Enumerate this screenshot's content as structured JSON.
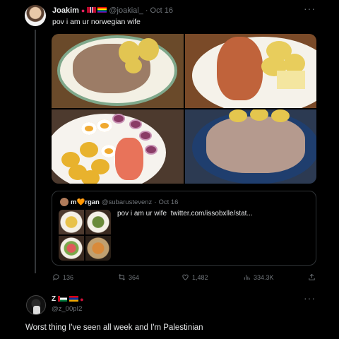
{
  "tweet": {
    "author_name": "Joakim",
    "author_emojis": "📍🇳🇴🏳️‍🌈",
    "handle": "@joakial_",
    "separator": "·",
    "date": "Oct 16",
    "text": "pov i am ur norwegian wife",
    "more": "···",
    "images": [
      "food-photo-1",
      "food-photo-2",
      "food-photo-3",
      "food-photo-4"
    ]
  },
  "quote": {
    "author_name": "m🧡rgan",
    "handle": "@subarustevenz",
    "separator": "·",
    "date": "Oct 16",
    "text": "pov i am ur wife",
    "link": "twitter.com/issobxlle/stat..."
  },
  "actions": {
    "replies": "136",
    "retweets": "364",
    "likes": "1,482",
    "views": "334.3K"
  },
  "reply": {
    "author_name": "Z",
    "handle": "@z_00pI2",
    "more": "···",
    "text": "Worst thing I've seen all week and I'm Palestinian"
  },
  "colors": {
    "background": "#000000",
    "text": "#e7e9ea",
    "muted": "#71767b",
    "border": "#2f3336"
  }
}
